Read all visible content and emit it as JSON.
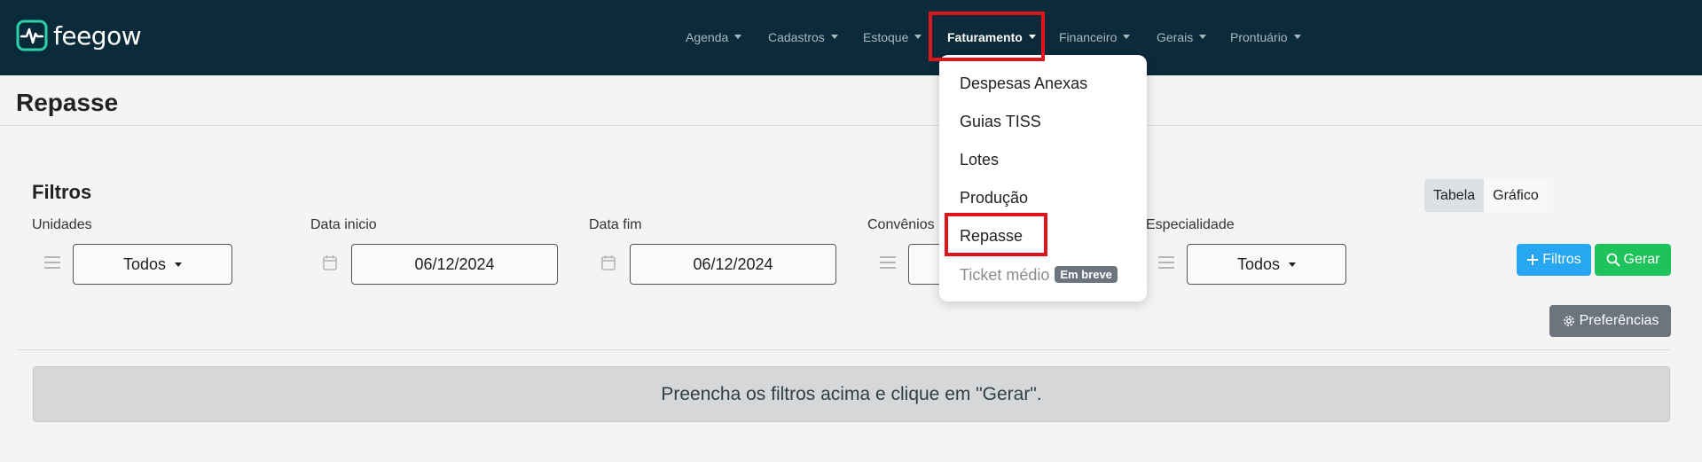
{
  "brand": {
    "name": "feegow"
  },
  "nav": [
    {
      "label": "Agenda",
      "active": false
    },
    {
      "label": "Cadastros",
      "active": false
    },
    {
      "label": "Estoque",
      "active": false
    },
    {
      "label": "Faturamento",
      "active": true
    },
    {
      "label": "Financeiro",
      "active": false
    },
    {
      "label": "Gerais",
      "active": false
    },
    {
      "label": "Prontuário",
      "active": false
    }
  ],
  "page": {
    "title": "Repasse"
  },
  "filters": {
    "title": "Filtros",
    "unidades": {
      "label": "Unidades",
      "value": "Todos"
    },
    "data_inicio": {
      "label": "Data inicio",
      "value": "06/12/2024"
    },
    "data_fim": {
      "label": "Data fim",
      "value": "06/12/2024"
    },
    "convenios": {
      "label": "Convênios",
      "value": ""
    },
    "especialidade": {
      "label": "Especialidade",
      "value": "Todos"
    }
  },
  "view_toggle": {
    "tabela": "Tabela",
    "grafico": "Gráfico",
    "selected": "Tabela"
  },
  "buttons": {
    "filtros": "Filtros",
    "gerar": "Gerar",
    "preferencias": "Preferências"
  },
  "alert": {
    "message": "Preencha os filtros acima e clique em \"Gerar\"."
  },
  "dropdown": {
    "items": [
      {
        "label": "Despesas Anexas"
      },
      {
        "label": "Guias TISS"
      },
      {
        "label": "Lotes"
      },
      {
        "label": "Produção"
      },
      {
        "label": "Repasse"
      },
      {
        "label": "Ticket médio",
        "badge": "Em breve",
        "disabled": true
      }
    ]
  },
  "colors": {
    "navbar": "#0b2b3a",
    "highlight": "#e0141c",
    "btn_filtros": "#27a7f2",
    "btn_gerar": "#1ec35b",
    "btn_pref": "#6c757d",
    "logo_accent": "#2fd0a8"
  }
}
